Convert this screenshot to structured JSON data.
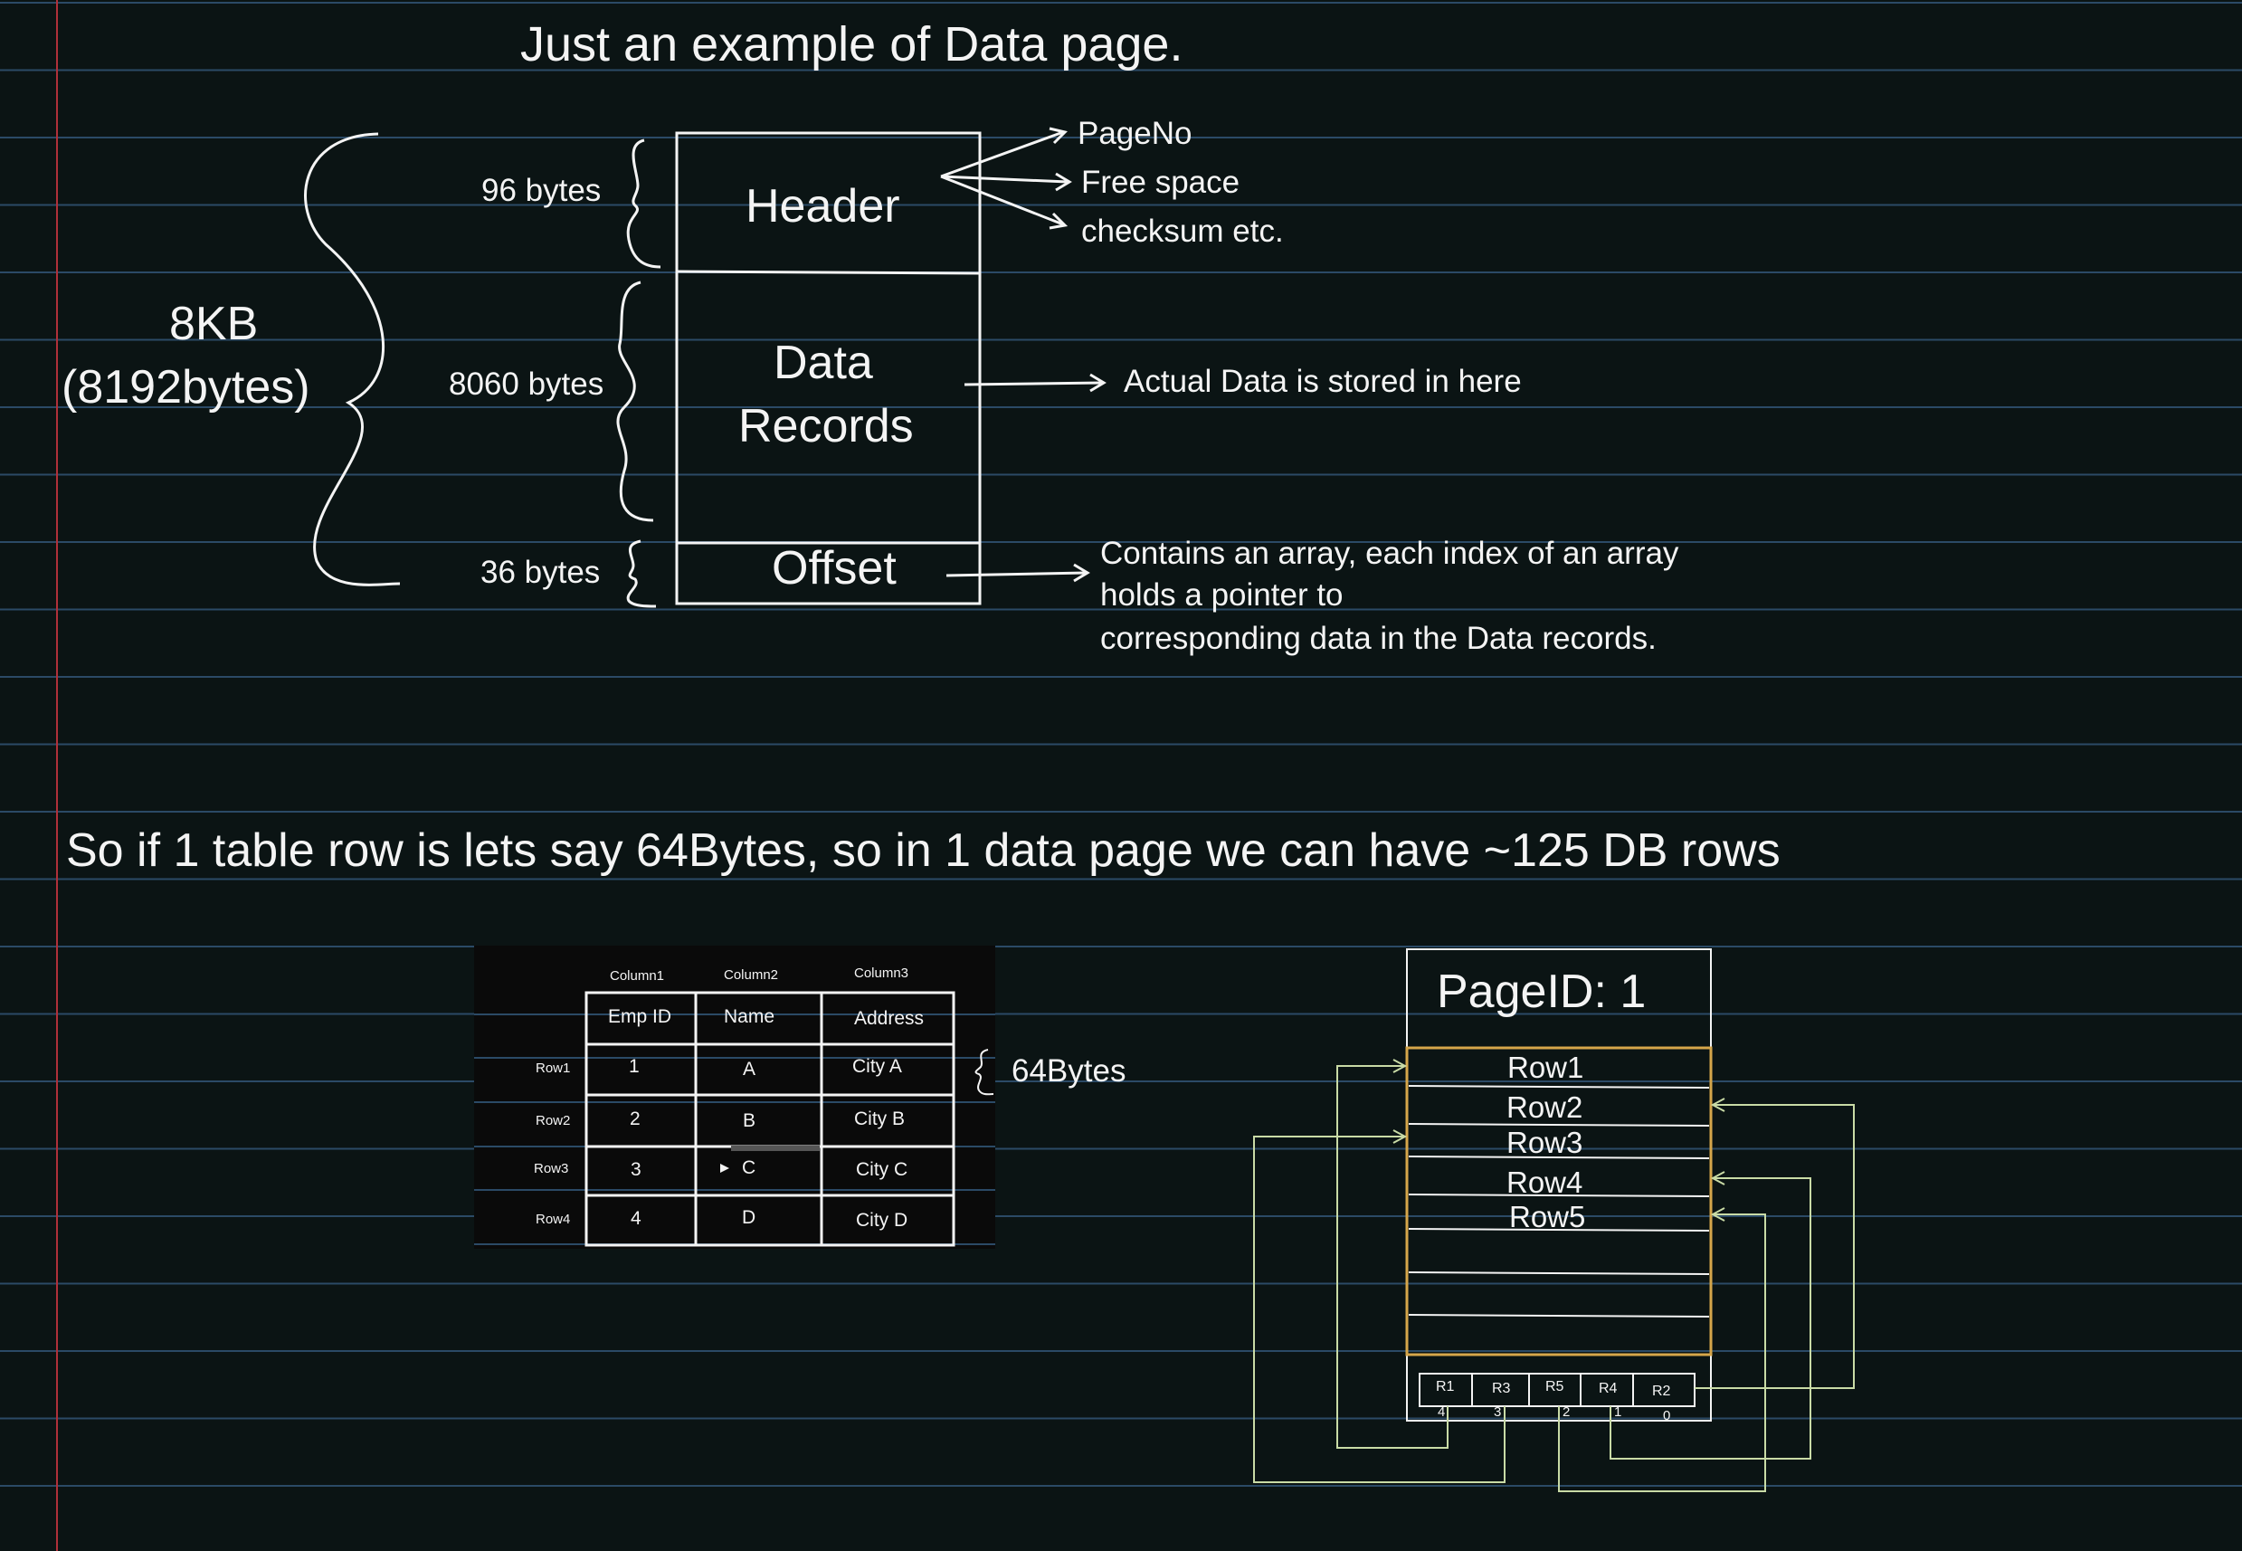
{
  "title": "Just an example of Data page.",
  "page_diagram": {
    "total_size": "8KB",
    "total_bytes": "(8192bytes)",
    "header": {
      "label": "Header",
      "size": "96 bytes"
    },
    "data_records": {
      "label_line1": "Data",
      "label_line2": "Records",
      "size": "8060 bytes"
    },
    "offset": {
      "label": "Offset",
      "size": "36 bytes"
    },
    "header_notes": [
      "PageNo",
      "Free space",
      "checksum etc."
    ],
    "data_note": "Actual Data is stored in here",
    "offset_note": [
      "Contains an array, each index of an array",
      "holds a pointer to",
      "corresponding data in the Data records."
    ]
  },
  "summary": "So if 1 table row is lets say 64Bytes, so in 1 data page we can have ~125 DB rows",
  "table": {
    "column_tags": [
      "Column1",
      "Column2",
      "Column3"
    ],
    "headers": [
      "Emp ID",
      "Name",
      "Address"
    ],
    "rows": [
      {
        "label": "Row1",
        "cells": [
          "1",
          "A",
          "City A"
        ]
      },
      {
        "label": "Row2",
        "cells": [
          "2",
          "B",
          "City B"
        ]
      },
      {
        "label": "Row3",
        "cells": [
          "3",
          "C",
          "City C"
        ]
      },
      {
        "label": "Row4",
        "cells": [
          "4",
          "D",
          "City D"
        ]
      }
    ],
    "row_size": "64Bytes"
  },
  "page_example": {
    "page_id": "PageID: 1",
    "rows": [
      "Row1",
      "Row2",
      "Row3",
      "Row4",
      "Row5"
    ],
    "offset_slots": [
      "R1",
      "R3",
      "R5",
      "R4",
      "R2"
    ],
    "offset_indices": [
      "4",
      "3",
      "2",
      "1",
      "0"
    ]
  },
  "colors": {
    "background": "#0b1414",
    "ruled_line": "#2b4a66",
    "margin_line": "#b0303a",
    "ink": "#f4f4f4",
    "highlight": "#d6a64a",
    "pointer": "#c9dba6"
  }
}
